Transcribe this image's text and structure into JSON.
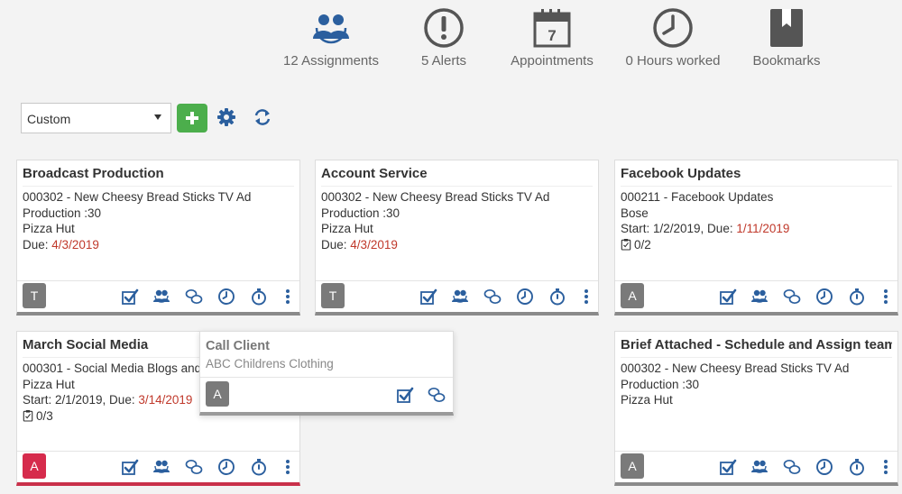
{
  "topnav": {
    "items": [
      {
        "label": "12 Assignments",
        "icon": "people-icon"
      },
      {
        "label": "5 Alerts",
        "icon": "alert-icon"
      },
      {
        "label": "Appointments",
        "icon": "calendar-icon",
        "calendar_day": "7"
      },
      {
        "label": "0 Hours worked",
        "icon": "clock-icon"
      },
      {
        "label": "Bookmarks",
        "icon": "bookmark-icon"
      }
    ]
  },
  "toolbar": {
    "view_select": "Custom",
    "icons": [
      "add-icon",
      "gear-icon",
      "refresh-icon"
    ]
  },
  "colors": {
    "accent": "#2b5f9e",
    "add_button": "#4cae4c",
    "due": "#c0392b",
    "alert_avatar": "#d62b4c"
  },
  "cards": [
    {
      "title": "Broadcast Production",
      "line1": "000302 - New Cheesy Bread Sticks TV Ad",
      "line2": "Production :30",
      "line3": "Pizza Hut",
      "due_label": "Due:",
      "due": "4/3/2019",
      "avatar": "T"
    },
    {
      "title": "Account Service",
      "line1": "000302 - New Cheesy Bread Sticks TV Ad",
      "line2": "Production :30",
      "line3": "Pizza Hut",
      "due_label": "Due:",
      "due": "4/3/2019",
      "avatar": "T"
    },
    {
      "title": "Facebook Updates",
      "line1": "000211 - Facebook Updates",
      "line2": "Bose",
      "start": "Start: 1/2/2019,  Due:",
      "due": "1/11/2019",
      "checklist": "0/2",
      "avatar": "A"
    },
    {
      "title": "March Social Media",
      "line1": "000301 - Social Media Blogs and",
      "line2": "Pizza Hut",
      "start": "Start: 2/1/2019,  Due:",
      "due": "3/14/2019",
      "checklist": "0/3",
      "avatar": "A"
    },
    {
      "title": "Brief Attached - Schedule and Assign team",
      "line1": "000302 - New Cheesy Bread Sticks TV Ad",
      "line2": "Production :30",
      "line3": "Pizza Hut",
      "avatar": "A"
    }
  ],
  "popup": {
    "title": "Call Client",
    "subtitle": "ABC Childrens Clothing",
    "avatar": "A"
  }
}
